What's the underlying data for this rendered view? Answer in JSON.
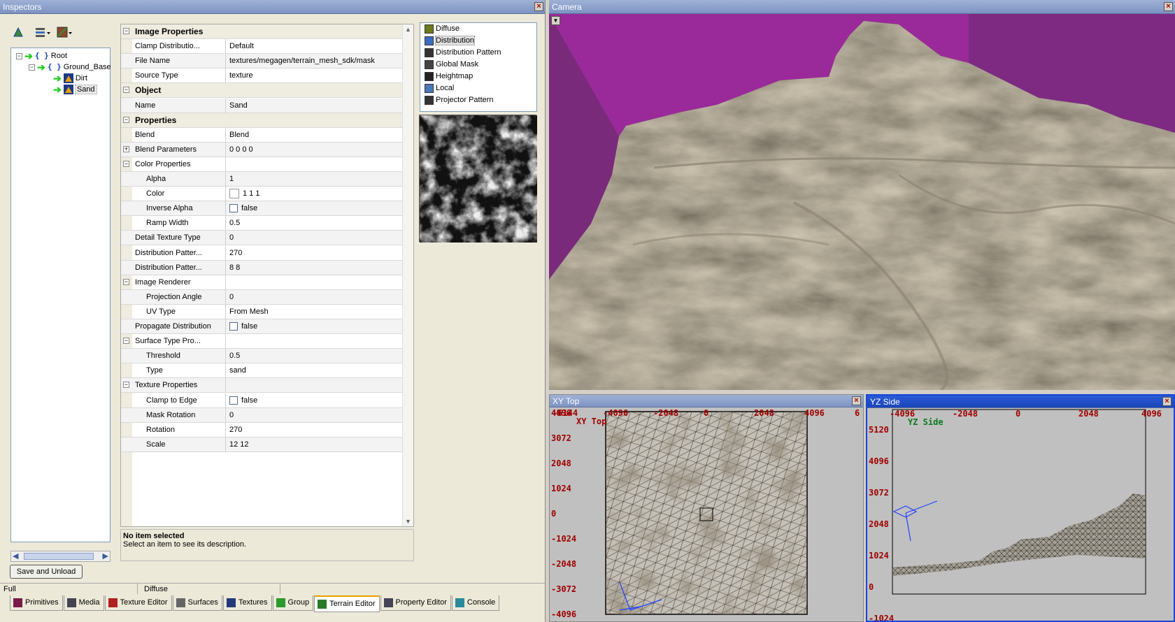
{
  "inspectors": {
    "title": "Inspectors",
    "tree": [
      {
        "label": "Root"
      },
      {
        "label": "Ground_Base"
      },
      {
        "label": "Dirt"
      },
      {
        "label": "Sand"
      }
    ],
    "properties": [
      {
        "type": "cat",
        "label": "Image Properties",
        "toggle": "−"
      },
      {
        "type": "row",
        "key": "Clamp Distributio...",
        "value": "Default"
      },
      {
        "type": "row",
        "key": "File Name",
        "value": "textures/megagen/terrain_mesh_sdk/mask"
      },
      {
        "type": "row",
        "key": "Source Type",
        "value": "texture"
      },
      {
        "type": "cat",
        "label": "Object",
        "toggle": "−"
      },
      {
        "type": "row",
        "key": "Name",
        "value": "Sand"
      },
      {
        "type": "cat",
        "label": "Properties",
        "toggle": "−"
      },
      {
        "type": "row",
        "key": "Blend",
        "value": "Blend"
      },
      {
        "type": "group",
        "key": "Blend Parameters",
        "value": "0 0 0 0",
        "toggle": "+"
      },
      {
        "type": "group",
        "key": "Color Properties",
        "value": "",
        "toggle": "−"
      },
      {
        "type": "sub",
        "key": "Alpha",
        "value": "1"
      },
      {
        "type": "sub",
        "key": "Color",
        "value": "1 1 1",
        "swatch": true
      },
      {
        "type": "sub",
        "key": "Inverse Alpha",
        "value": "false",
        "check": true
      },
      {
        "type": "sub",
        "key": "Ramp Width",
        "value": "0.5"
      },
      {
        "type": "row",
        "key": "Detail Texture Type",
        "value": "0"
      },
      {
        "type": "row",
        "key": "Distribution Patter...",
        "value": "270"
      },
      {
        "type": "row",
        "key": "Distribution Patter...",
        "value": "8 8"
      },
      {
        "type": "group",
        "key": "Image Renderer",
        "value": "",
        "toggle": "−"
      },
      {
        "type": "sub",
        "key": "Projection Angle",
        "value": "0"
      },
      {
        "type": "sub",
        "key": "UV Type",
        "value": "From Mesh"
      },
      {
        "type": "row",
        "key": "Propagate Distribution",
        "value": "false",
        "check": true
      },
      {
        "type": "group",
        "key": "Surface Type Pro...",
        "value": "",
        "toggle": "−"
      },
      {
        "type": "sub",
        "key": "Threshold",
        "value": "0.5"
      },
      {
        "type": "sub",
        "key": "Type",
        "value": "sand"
      },
      {
        "type": "group",
        "key": "Texture Properties",
        "value": "",
        "toggle": "−"
      },
      {
        "type": "sub",
        "key": "Clamp to Edge",
        "value": "false",
        "check": true
      },
      {
        "type": "sub",
        "key": "Mask Rotation",
        "value": "0"
      },
      {
        "type": "sub",
        "key": "Rotation",
        "value": "270"
      },
      {
        "type": "sub",
        "key": "Scale",
        "value": "12 12"
      }
    ],
    "description": {
      "title": "No item selected",
      "text": "Select an item to see its description."
    },
    "layers": [
      {
        "label": "Diffuse",
        "icon": "diffuse-icon",
        "color": "#6b7a1a"
      },
      {
        "label": "Distribution",
        "icon": "distribution-icon",
        "color": "#3a6cc0",
        "selected": true
      },
      {
        "label": "Distribution Pattern",
        "icon": "distribution-pattern-icon",
        "color": "#333"
      },
      {
        "label": "Global Mask",
        "icon": "global-mask-icon",
        "color": "#444"
      },
      {
        "label": "Heightmap",
        "icon": "heightmap-icon",
        "color": "#222"
      },
      {
        "label": "Local",
        "icon": "local-icon",
        "color": "#4a78b8"
      },
      {
        "label": "Projector Pattern",
        "icon": "projector-pattern-icon",
        "color": "#333"
      }
    ],
    "save_button": "Save and Unload",
    "status": {
      "left": "Full",
      "right": "Diffuse"
    },
    "tabs": [
      {
        "label": "Primitives",
        "color": "#7a1a4a"
      },
      {
        "label": "Media",
        "color": "#445"
      },
      {
        "label": "Texture Editor",
        "color": "#b02020"
      },
      {
        "label": "Surfaces",
        "color": "#666"
      },
      {
        "label": "Textures",
        "color": "#223a7a"
      },
      {
        "label": "Group",
        "color": "#2a9a2a"
      },
      {
        "label": "Terrain Editor",
        "color": "#2a7a2a",
        "active": true
      },
      {
        "label": "Property Editor",
        "color": "#445"
      },
      {
        "label": "Console",
        "color": "#2a8a9a"
      }
    ]
  },
  "camera": {
    "title": "Camera"
  },
  "xy": {
    "title": "XY Top",
    "label": "XY Top",
    "top_ticks": [
      "-6144",
      "-4096",
      "-2048",
      "0",
      "2048",
      "4096",
      "6"
    ],
    "left_ticks": [
      "4096",
      "3072",
      "2048",
      "1024",
      "0",
      "-1024",
      "-2048",
      "-3072",
      "-4096"
    ]
  },
  "yz": {
    "title": "YZ Side",
    "label": "YZ Side",
    "top_ticks": [
      "-4096",
      "-2048",
      "0",
      "2048",
      "4096"
    ],
    "left_ticks": [
      "5120",
      "4096",
      "3072",
      "2048",
      "1024",
      "0",
      "-1024"
    ]
  },
  "colors": {
    "sky": "#9a2a9a",
    "terrain": "#5c5446",
    "accent": "#e8a000"
  }
}
